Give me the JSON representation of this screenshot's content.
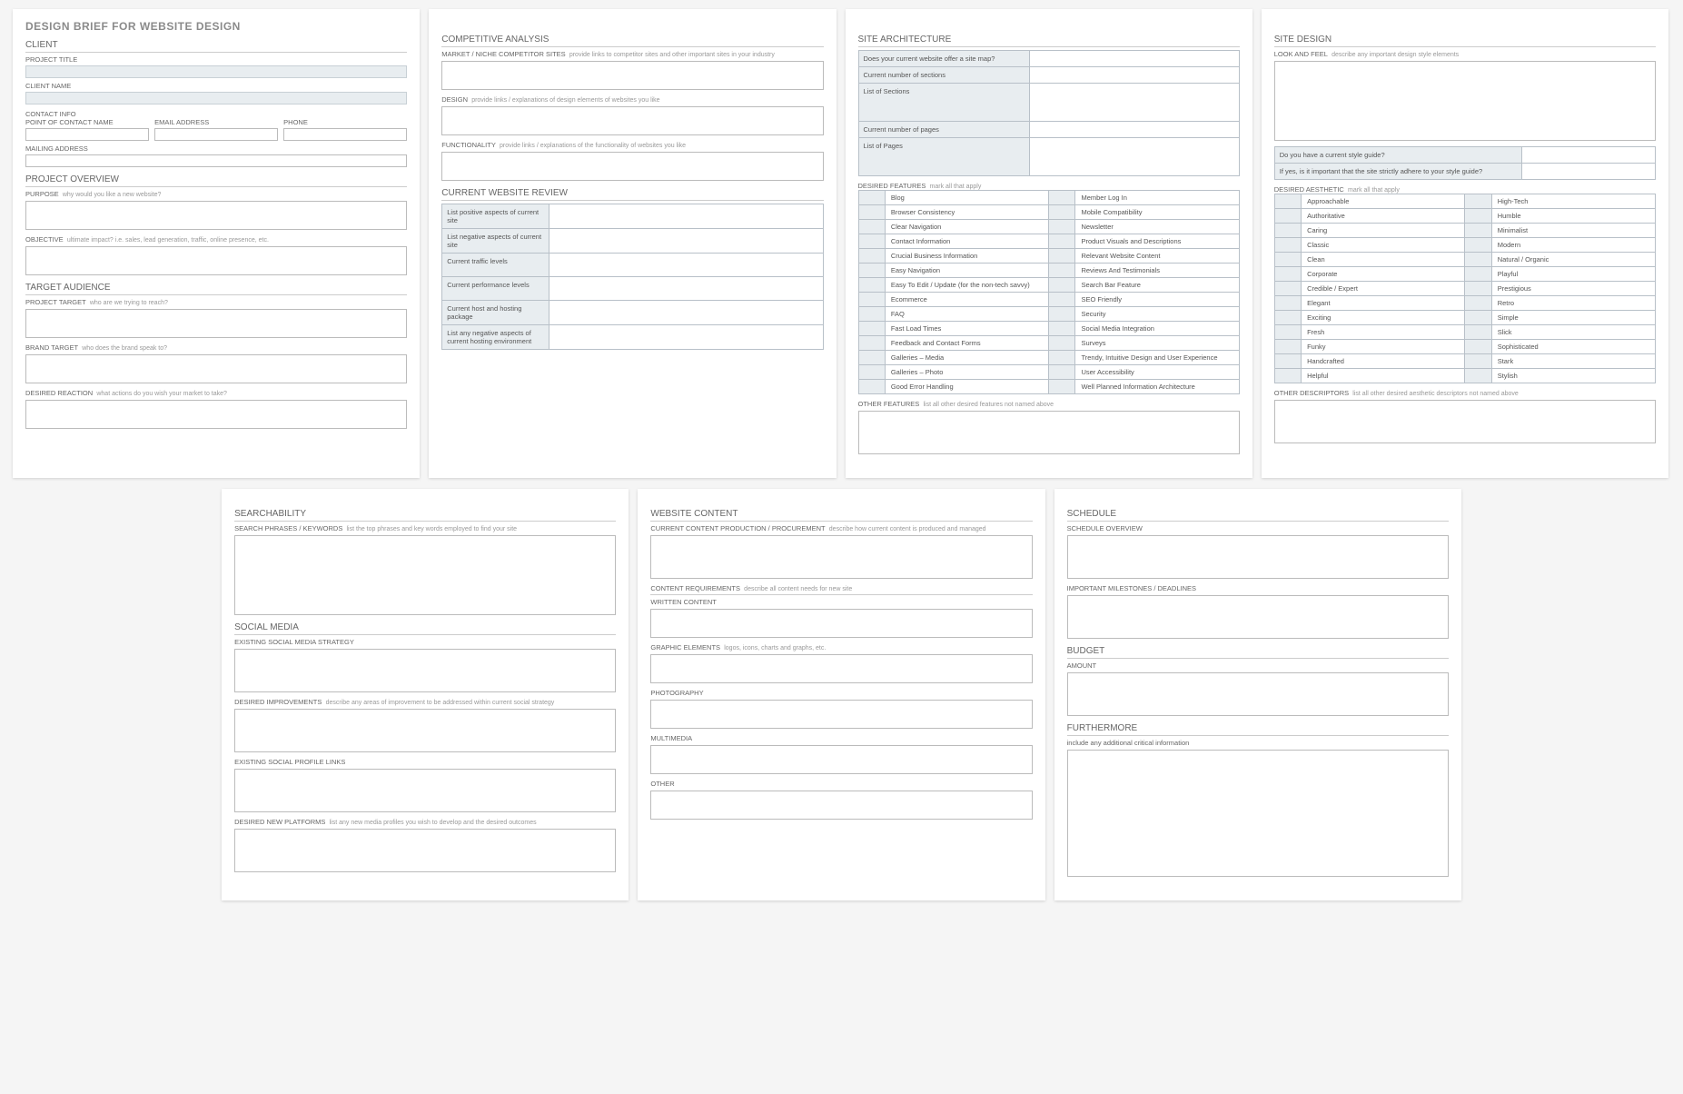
{
  "doc_title": "DESIGN BRIEF FOR WEBSITE DESIGN",
  "client": {
    "heading": "CLIENT",
    "project_title": "PROJECT TITLE",
    "client_name": "CLIENT NAME",
    "contact_info": "CONTACT INFO",
    "poc": "POINT OF CONTACT NAME",
    "email": "EMAIL ADDRESS",
    "phone": "PHONE",
    "mailing": "MAILING ADDRESS"
  },
  "overview": {
    "heading": "PROJECT OVERVIEW",
    "purpose_lbl": "PURPOSE",
    "purpose_desc": "why would you like a new website?",
    "objective_lbl": "OBJECTIVE",
    "objective_desc": "ultimate impact?  i.e. sales, lead generation, traffic, online presence, etc."
  },
  "audience": {
    "heading": "TARGET AUDIENCE",
    "project_target_lbl": "PROJECT TARGET",
    "project_target_desc": "who are we trying to reach?",
    "brand_target_lbl": "BRAND TARGET",
    "brand_target_desc": "who does the brand speak to?",
    "reaction_lbl": "DESIRED REACTION",
    "reaction_desc": "what actions do you wish your market to take?"
  },
  "competitive": {
    "heading": "COMPETITIVE ANALYSIS",
    "market_lbl": "MARKET / NICHE COMPETITOR SITES",
    "market_desc": "provide links to competitor sites and other important sites in your industry",
    "design_lbl": "DESIGN",
    "design_desc": "provide links / explanations of design elements of websites you like",
    "func_lbl": "FUNCTIONALITY",
    "func_desc": "provide links / explanations of the functionality of websites you like"
  },
  "review": {
    "heading": "CURRENT WEBSITE REVIEW",
    "rows": [
      "List positive aspects of current site",
      "List negative aspects of current site",
      "Current traffic levels",
      "Current performance levels",
      "Current host and hosting package",
      "List any negative aspects of current hosting environment"
    ]
  },
  "architecture": {
    "heading": "SITE ARCHITECTURE",
    "q_sitemap": "Does your current website offer a site map?",
    "q_sections": "Current number of sections",
    "q_list_sections": "List of Sections",
    "q_pages": "Current number of pages",
    "q_list_pages": "List of Pages",
    "features_lbl": "DESIRED FEATURES",
    "features_desc": "mark all that apply",
    "features_left": [
      "Blog",
      "Browser Consistency",
      "Clear Navigation",
      "Contact Information",
      "Crucial Business Information",
      "Easy Navigation",
      "Easy To Edit / Update (for the non-tech savvy)",
      "Ecommerce",
      "FAQ",
      "Fast Load Times",
      "Feedback and Contact Forms",
      "Galleries – Media",
      "Galleries – Photo",
      "Good Error Handling"
    ],
    "features_right": [
      "Member Log In",
      "Mobile Compatibility",
      "Newsletter",
      "Product Visuals and Descriptions",
      "Relevant Website Content",
      "Reviews And Testimonials",
      "Search Bar Feature",
      "SEO Friendly",
      "Security",
      "Social Media Integration",
      "Surveys",
      "Trendy, Intuitive Design and User Experience",
      "User Accessibility",
      "Well Planned Information Architecture"
    ],
    "other_lbl": "OTHER FEATURES",
    "other_desc": "list all other desired features not named above"
  },
  "sitedesign": {
    "heading": "SITE DESIGN",
    "look_lbl": "LOOK AND FEEL",
    "look_desc": "describe any important design style elements",
    "style_q1": "Do you have a current style guide?",
    "style_q2": "If yes, is it important that the site strictly adhere to your style guide?",
    "aesthetic_lbl": "DESIRED AESTHETIC",
    "aesthetic_desc": "mark all that apply",
    "aesth_left": [
      "Approachable",
      "Authoritative",
      "Caring",
      "Classic",
      "Clean",
      "Corporate",
      "Credible / Expert",
      "Elegant",
      "Exciting",
      "Fresh",
      "Funky",
      "Handcrafted",
      "Helpful"
    ],
    "aesth_right": [
      "High-Tech",
      "Humble",
      "Minimalist",
      "Modern",
      "Natural / Organic",
      "Playful",
      "Prestigious",
      "Retro",
      "Simple",
      "Slick",
      "Sophisticated",
      "Stark",
      "Stylish"
    ],
    "other_lbl": "OTHER DESCRIPTORS",
    "other_desc": "list all other desired aesthetic descriptors not named above"
  },
  "search": {
    "heading": "SEARCHABILITY",
    "phrases_lbl": "SEARCH PHRASES / KEYWORDS",
    "phrases_desc": "list the top phrases and key words employed to find your site"
  },
  "social": {
    "heading": "SOCIAL MEDIA",
    "existing_strategy": "EXISTING SOCIAL MEDIA STRATEGY",
    "improvements_lbl": "DESIRED IMPROVEMENTS",
    "improvements_desc": "describe any areas of improvement to be addressed within current social strategy",
    "profile_links": "EXISTING SOCIAL PROFILE LINKS",
    "new_platforms_lbl": "DESIRED NEW PLATFORMS",
    "new_platforms_desc": "list any new media profiles you wish to develop and the desired outcomes"
  },
  "content": {
    "heading": "WEBSITE CONTENT",
    "current_lbl": "CURRENT CONTENT PRODUCTION / PROCUREMENT",
    "current_desc": "describe how current content is produced and managed",
    "requirements_lbl": "CONTENT REQUIREMENTS",
    "requirements_desc": "describe all content needs for new site",
    "written": "WRITTEN CONTENT",
    "graphic_lbl": "GRAPHIC ELEMENTS",
    "graphic_desc": "logos, icons, charts and graphs, etc.",
    "photography": "PHOTOGRAPHY",
    "multimedia": "MULTIMEDIA",
    "other": "OTHER"
  },
  "schedule": {
    "heading": "SCHEDULE",
    "overview": "SCHEDULE OVERVIEW",
    "milestones": "IMPORTANT MILESTONES / DEADLINES"
  },
  "budget": {
    "heading": "BUDGET",
    "amount": "AMOUNT"
  },
  "furthermore": {
    "heading": "FURTHERMORE",
    "desc": "include any additional critical information"
  }
}
